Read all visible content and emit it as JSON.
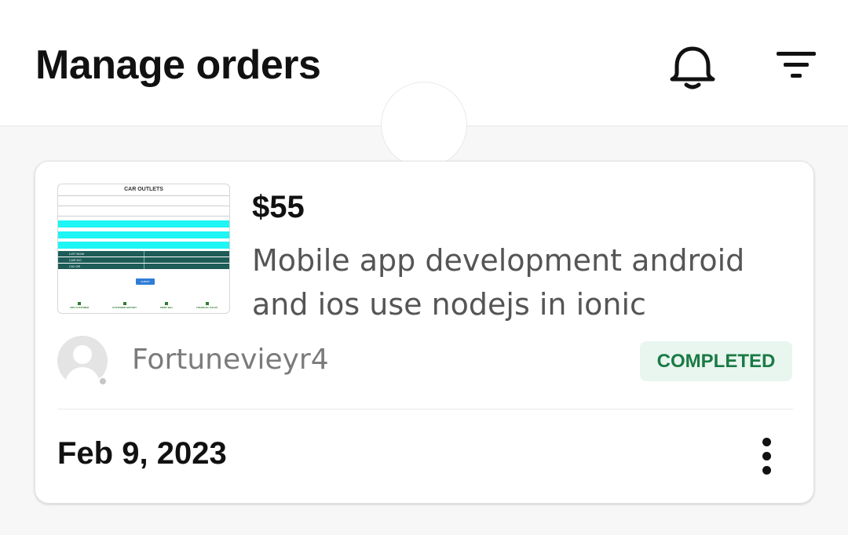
{
  "header": {
    "title": "Manage orders",
    "icons": [
      "bell-icon",
      "filter-icon"
    ]
  },
  "order": {
    "thumbnail": {
      "title": "CAR OUTLETS",
      "rows": [
        "LIST NOW",
        "CAR NO",
        "CIG OR"
      ],
      "button": "SUBMIT",
      "nav": [
        "ADD CUSTOMER",
        "CUSTOMER HISTORY",
        "PRINT BILL",
        "FINANCIAL SALES"
      ]
    },
    "price": "$55",
    "description": "Mobile app development android and ios use nodejs in ionic",
    "username": "Fortunevieyr4",
    "status": "COMPLETED",
    "date": "Feb 9, 2023"
  },
  "colors": {
    "status_bg": "#e8f6ef",
    "status_text": "#1b7a45"
  }
}
